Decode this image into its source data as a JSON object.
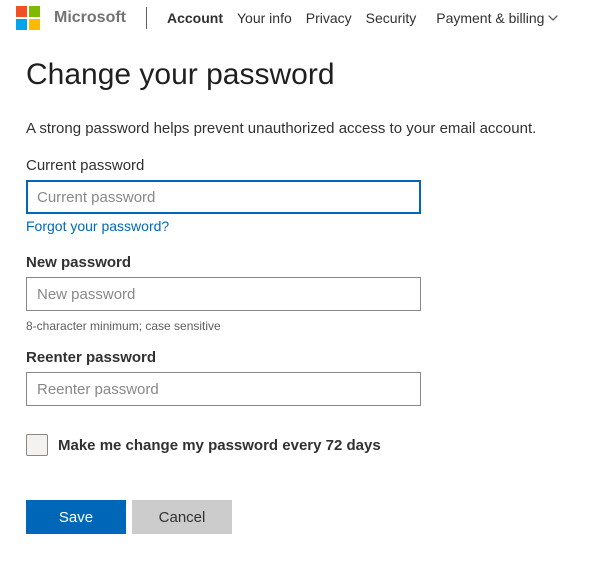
{
  "header": {
    "brand": "Microsoft",
    "nav": {
      "account": "Account",
      "your_info": "Your info",
      "privacy": "Privacy",
      "security": "Security",
      "billing": "Payment & billing"
    }
  },
  "page": {
    "title": "Change your password",
    "help_text": "A strong password helps prevent unauthorized access to your email account."
  },
  "form": {
    "current": {
      "label": "Current password",
      "placeholder": "Current password",
      "value": "",
      "forgot_link": "Forgot your password?"
    },
    "new": {
      "label": "New password",
      "placeholder": "New password",
      "value": "",
      "hint": "8-character minimum; case sensitive"
    },
    "reenter": {
      "label": "Reenter password",
      "placeholder": "Reenter password",
      "value": ""
    },
    "rotate_checkbox": {
      "label": "Make me change my password every 72 days",
      "checked": false
    },
    "buttons": {
      "save": "Save",
      "cancel": "Cancel"
    }
  }
}
